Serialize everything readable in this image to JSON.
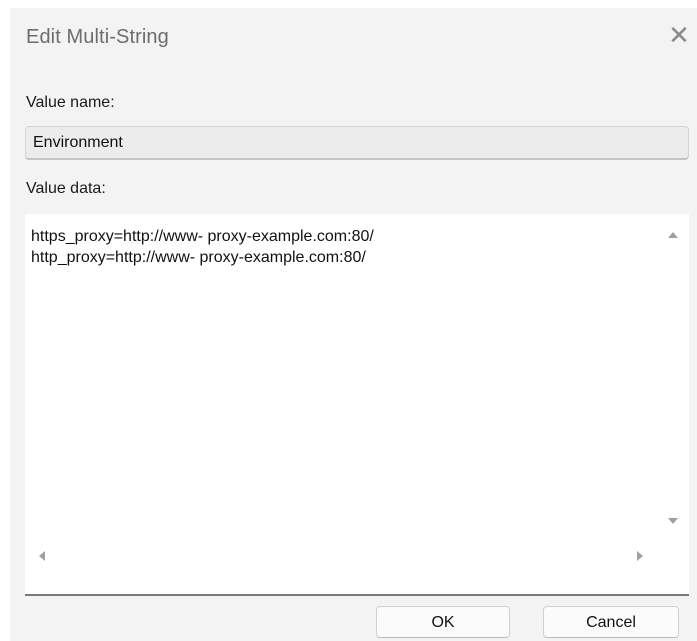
{
  "dialog": {
    "title": "Edit Multi-String",
    "close_icon": "close-icon",
    "value_name_label": "Value name:",
    "value_name": "Environment",
    "value_data_label": "Value data:",
    "value_data_lines": [
      "https_proxy=http://www- proxy-example.com:80/",
      "http_proxy=http://www- proxy-example.com:80/"
    ],
    "ok_label": "OK",
    "cancel_label": "Cancel"
  },
  "colors": {
    "dialog_background": "#f3f3f3",
    "text": "#1a1a1a",
    "title_text": "#6d6d6d"
  }
}
